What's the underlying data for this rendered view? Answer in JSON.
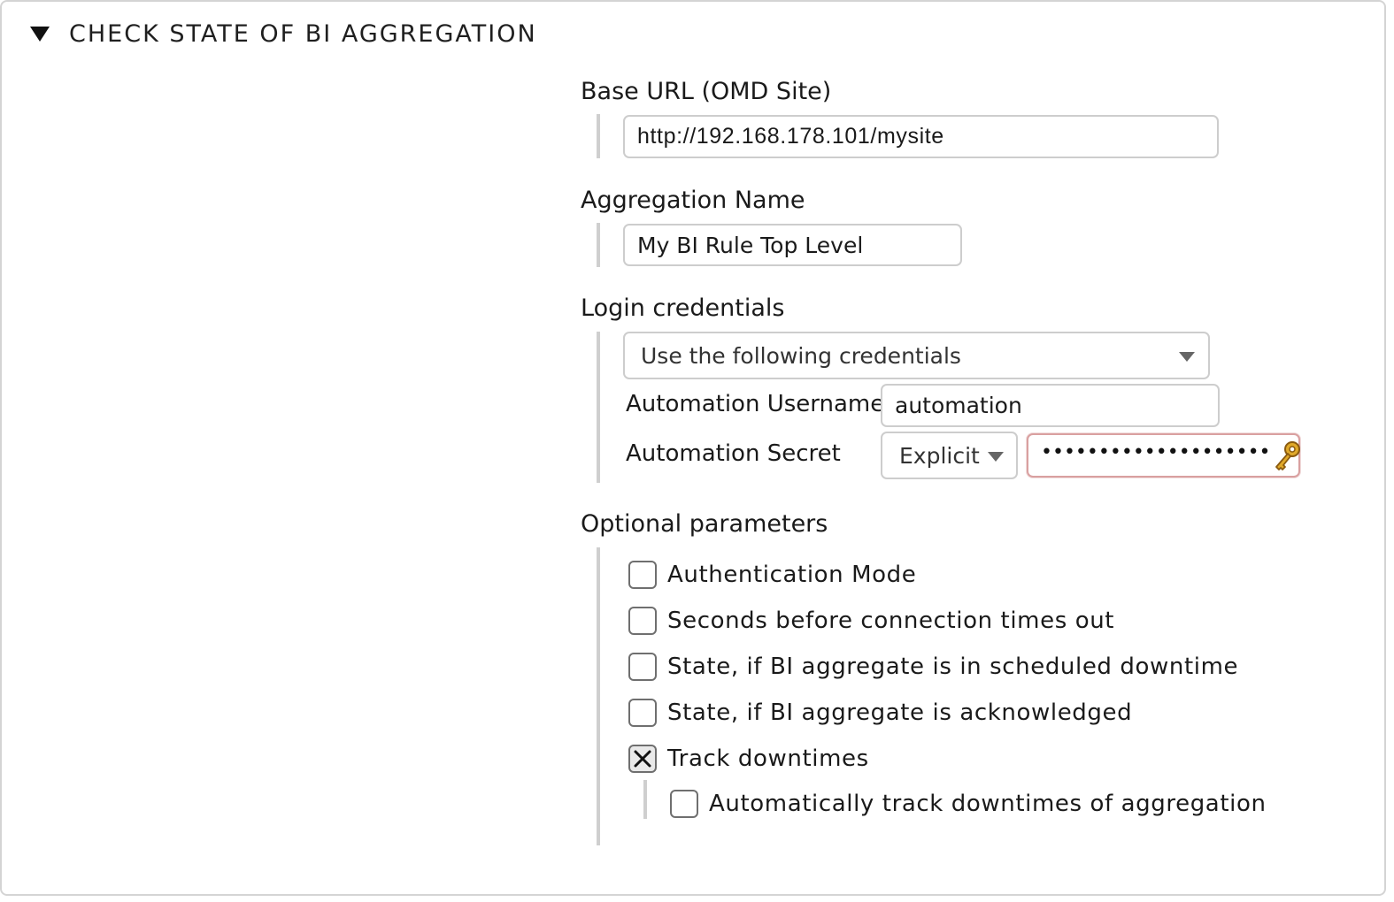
{
  "section": {
    "title": "CHECK STATE OF BI AGGREGATION",
    "expanded_icon": "triangle-down-icon"
  },
  "base_url": {
    "label": "Base URL (OMD Site)",
    "value": "http://192.168.178.101/mysite"
  },
  "aggregation_name": {
    "label": "Aggregation Name",
    "value": "My BI Rule Top Level"
  },
  "login": {
    "label": "Login credentials",
    "mode_selected": "Use the following credentials",
    "username_label": "Automation Username",
    "username_value": "automation",
    "secret_label": "Automation Secret",
    "secret_mode": "Explicit",
    "secret_masked": "••••••••••••••••••••",
    "secret_icon": "key-icon"
  },
  "optional": {
    "label": "Optional parameters",
    "options": [
      {
        "label": "Authentication Mode",
        "checked": false
      },
      {
        "label": "Seconds before connection times out",
        "checked": false
      },
      {
        "label": "State, if BI aggregate is in scheduled downtime",
        "checked": false
      },
      {
        "label": "State, if BI aggregate is acknowledged",
        "checked": false
      },
      {
        "label": "Track downtimes",
        "checked": true
      }
    ],
    "sub_option": {
      "label": "Automatically track downtimes of aggregation",
      "checked": false
    }
  }
}
